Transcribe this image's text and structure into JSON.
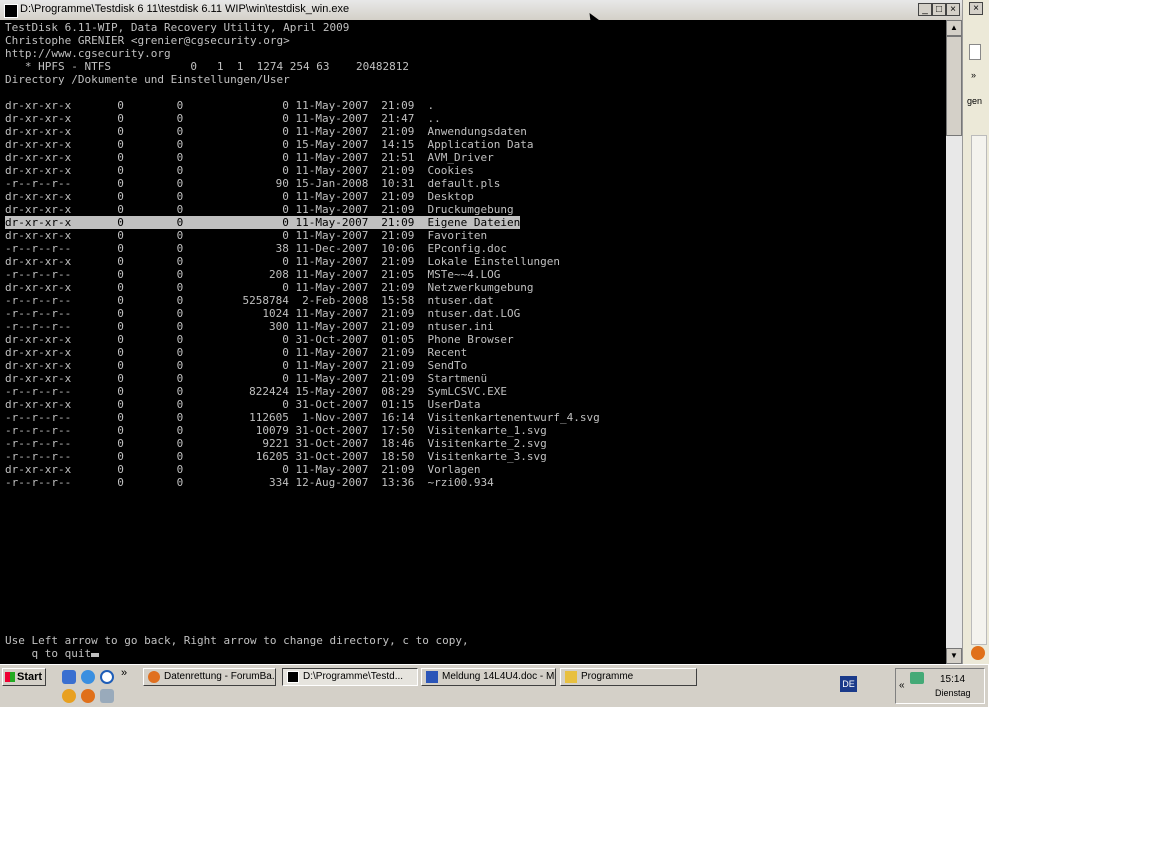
{
  "window": {
    "title": "D:\\Programme\\Testdisk 6 11\\testdisk 6.11 WIP\\win\\testdisk_win.exe",
    "minimize": "_",
    "maximize": "□",
    "close": "×"
  },
  "terminal": {
    "header": [
      "TestDisk 6.11-WIP, Data Recovery Utility, April 2009",
      "Christophe GRENIER <grenier@cgsecurity.org>",
      "http://www.cgsecurity.org",
      "   * HPFS - NTFS            0   1  1  1274 254 63    20482812",
      "Directory /Dokumente und Einstellungen/User"
    ],
    "rows": [
      {
        "perm": "dr-xr-xr-x",
        "uid": "0",
        "gid": "0",
        "size": "0",
        "date": "11-May-2007",
        "time": "21:09",
        "name": "."
      },
      {
        "perm": "dr-xr-xr-x",
        "uid": "0",
        "gid": "0",
        "size": "0",
        "date": "11-May-2007",
        "time": "21:47",
        "name": ".."
      },
      {
        "perm": "dr-xr-xr-x",
        "uid": "0",
        "gid": "0",
        "size": "0",
        "date": "11-May-2007",
        "time": "21:09",
        "name": "Anwendungsdaten"
      },
      {
        "perm": "dr-xr-xr-x",
        "uid": "0",
        "gid": "0",
        "size": "0",
        "date": "15-May-2007",
        "time": "14:15",
        "name": "Application Data"
      },
      {
        "perm": "dr-xr-xr-x",
        "uid": "0",
        "gid": "0",
        "size": "0",
        "date": "11-May-2007",
        "time": "21:51",
        "name": "AVM_Driver"
      },
      {
        "perm": "dr-xr-xr-x",
        "uid": "0",
        "gid": "0",
        "size": "0",
        "date": "11-May-2007",
        "time": "21:09",
        "name": "Cookies"
      },
      {
        "perm": "-r--r--r--",
        "uid": "0",
        "gid": "0",
        "size": "90",
        "date": "15-Jan-2008",
        "time": "10:31",
        "name": "default.pls"
      },
      {
        "perm": "dr-xr-xr-x",
        "uid": "0",
        "gid": "0",
        "size": "0",
        "date": "11-May-2007",
        "time": "21:09",
        "name": "Desktop"
      },
      {
        "perm": "dr-xr-xr-x",
        "uid": "0",
        "gid": "0",
        "size": "0",
        "date": "11-May-2007",
        "time": "21:09",
        "name": "Druckumgebung"
      },
      {
        "perm": "dr-xr-xr-x",
        "uid": "0",
        "gid": "0",
        "size": "0",
        "date": "11-May-2007",
        "time": "21:09",
        "name": "Eigene Dateien",
        "selected": true
      },
      {
        "perm": "dr-xr-xr-x",
        "uid": "0",
        "gid": "0",
        "size": "0",
        "date": "11-May-2007",
        "time": "21:09",
        "name": "Favoriten"
      },
      {
        "perm": "-r--r--r--",
        "uid": "0",
        "gid": "0",
        "size": "38",
        "date": "11-Dec-2007",
        "time": "10:06",
        "name": "EPconfig.doc"
      },
      {
        "perm": "dr-xr-xr-x",
        "uid": "0",
        "gid": "0",
        "size": "0",
        "date": "11-May-2007",
        "time": "21:09",
        "name": "Lokale Einstellungen"
      },
      {
        "perm": "-r--r--r--",
        "uid": "0",
        "gid": "0",
        "size": "208",
        "date": "11-May-2007",
        "time": "21:05",
        "name": "MSTe~~4.LOG"
      },
      {
        "perm": "dr-xr-xr-x",
        "uid": "0",
        "gid": "0",
        "size": "0",
        "date": "11-May-2007",
        "time": "21:09",
        "name": "Netzwerkumgebung"
      },
      {
        "perm": "-r--r--r--",
        "uid": "0",
        "gid": "0",
        "size": "5258784",
        "date": " 2-Feb-2008",
        "time": "15:58",
        "name": "ntuser.dat"
      },
      {
        "perm": "-r--r--r--",
        "uid": "0",
        "gid": "0",
        "size": "1024",
        "date": "11-May-2007",
        "time": "21:09",
        "name": "ntuser.dat.LOG"
      },
      {
        "perm": "-r--r--r--",
        "uid": "0",
        "gid": "0",
        "size": "300",
        "date": "11-May-2007",
        "time": "21:09",
        "name": "ntuser.ini"
      },
      {
        "perm": "dr-xr-xr-x",
        "uid": "0",
        "gid": "0",
        "size": "0",
        "date": "31-Oct-2007",
        "time": "01:05",
        "name": "Phone Browser"
      },
      {
        "perm": "dr-xr-xr-x",
        "uid": "0",
        "gid": "0",
        "size": "0",
        "date": "11-May-2007",
        "time": "21:09",
        "name": "Recent"
      },
      {
        "perm": "dr-xr-xr-x",
        "uid": "0",
        "gid": "0",
        "size": "0",
        "date": "11-May-2007",
        "time": "21:09",
        "name": "SendTo"
      },
      {
        "perm": "dr-xr-xr-x",
        "uid": "0",
        "gid": "0",
        "size": "0",
        "date": "11-May-2007",
        "time": "21:09",
        "name": "Startmenü"
      },
      {
        "perm": "-r--r--r--",
        "uid": "0",
        "gid": "0",
        "size": "822424",
        "date": "15-May-2007",
        "time": "08:29",
        "name": "SymLCSVC.EXE"
      },
      {
        "perm": "dr-xr-xr-x",
        "uid": "0",
        "gid": "0",
        "size": "0",
        "date": "31-Oct-2007",
        "time": "01:15",
        "name": "UserData"
      },
      {
        "perm": "-r--r--r--",
        "uid": "0",
        "gid": "0",
        "size": "112605",
        "date": " 1-Nov-2007",
        "time": "16:14",
        "name": "Visitenkartenentwurf_4.svg"
      },
      {
        "perm": "-r--r--r--",
        "uid": "0",
        "gid": "0",
        "size": "10079",
        "date": "31-Oct-2007",
        "time": "17:50",
        "name": "Visitenkarte_1.svg"
      },
      {
        "perm": "-r--r--r--",
        "uid": "0",
        "gid": "0",
        "size": "9221",
        "date": "31-Oct-2007",
        "time": "18:46",
        "name": "Visitenkarte_2.svg"
      },
      {
        "perm": "-r--r--r--",
        "uid": "0",
        "gid": "0",
        "size": "16205",
        "date": "31-Oct-2007",
        "time": "18:50",
        "name": "Visitenkarte_3.svg"
      },
      {
        "perm": "dr-xr-xr-x",
        "uid": "0",
        "gid": "0",
        "size": "0",
        "date": "11-May-2007",
        "time": "21:09",
        "name": "Vorlagen"
      },
      {
        "perm": "-r--r--r--",
        "uid": "0",
        "gid": "0",
        "size": "334",
        "date": "12-Aug-2007",
        "time": "13:36",
        "name": "~rzi00.934"
      }
    ],
    "footer": [
      "Use Left arrow to go back, Right arrow to change directory, c to copy,",
      "    q to quit"
    ]
  },
  "background_window": {
    "close": "×",
    "chevron": "»",
    "label": "gen"
  },
  "taskbar": {
    "start_label": "Start",
    "chevron": "»",
    "tasks": [
      {
        "label": "Datenrettung - ForumBa...",
        "icon_color": "#e07020"
      },
      {
        "label": "D:\\Programme\\Testd...",
        "icon_color": "#000000",
        "active": true
      },
      {
        "label": "Meldung 14L4U4.doc - Mi...",
        "icon_color": "#2b55b8"
      },
      {
        "label": "Programme",
        "icon_color": "#e8c040"
      }
    ],
    "language": "DE",
    "tray_chevron": "«",
    "clock": "15:14",
    "day": "Dienstag"
  }
}
